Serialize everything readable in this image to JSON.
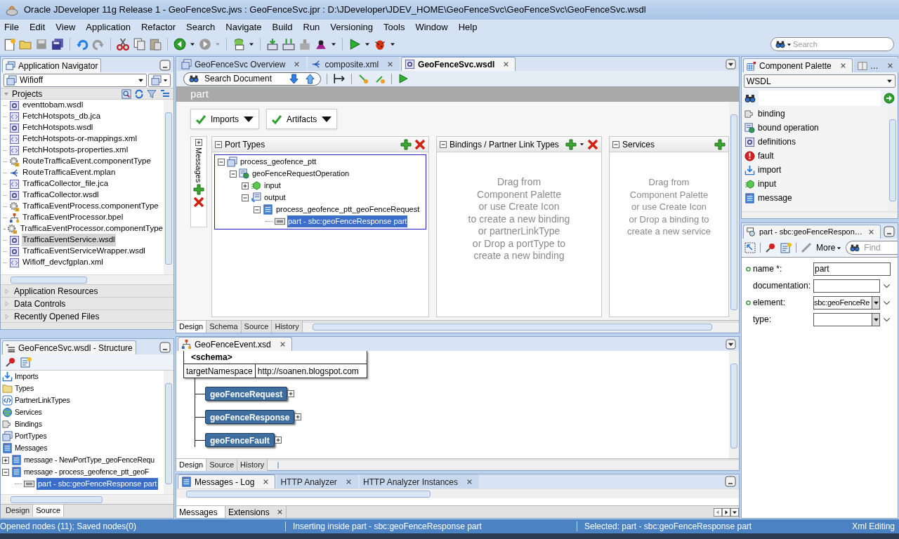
{
  "window": {
    "title": "Oracle JDeveloper 11g Release 1 - GeoFenceSvc.jws : GeoFenceSvc.jpr : D:\\JDeveloper\\JDEV_HOME\\GeoFenceSvc\\GeoFenceSvc\\GeoFenceSvc.wsdl"
  },
  "menu": [
    "File",
    "Edit",
    "View",
    "Application",
    "Refactor",
    "Search",
    "Navigate",
    "Build",
    "Run",
    "Versioning",
    "Tools",
    "Window",
    "Help"
  ],
  "search": {
    "placeholder": "Search"
  },
  "navigator": {
    "tab": "Application Navigator",
    "app": "Wifioff",
    "section": "Projects",
    "files": [
      {
        "name": "eventtobam.wsdl",
        "kind": "wsdl",
        "selected": false
      },
      {
        "name": "FetchHotspots_db.jca",
        "kind": "xml",
        "selected": false
      },
      {
        "name": "FetchHotspots.wsdl",
        "kind": "wsdl",
        "selected": false
      },
      {
        "name": "FetchHotspots-or-mappings.xml",
        "kind": "xml",
        "selected": false
      },
      {
        "name": "FetchHotspots-properties.xml",
        "kind": "xml",
        "selected": false
      },
      {
        "name": "RouteTrafficaEvent.componentType",
        "kind": "gear",
        "selected": false
      },
      {
        "name": "RouteTrafficaEvent.mplan",
        "kind": "mplan",
        "selected": false
      },
      {
        "name": "TrafficaCollector_file.jca",
        "kind": "xml",
        "selected": false
      },
      {
        "name": "TrafficaCollector.wsdl",
        "kind": "wsdl",
        "selected": false
      },
      {
        "name": "TrafficaEventProcess.componentType",
        "kind": "gear",
        "selected": false
      },
      {
        "name": "TrafficaEventProcessor.bpel",
        "kind": "bpel",
        "selected": false
      },
      {
        "name": "TrafficaEventProcessor.componentType",
        "kind": "gear",
        "selected": false
      },
      {
        "name": "TrafficaEventService.wsdl",
        "kind": "wsdl",
        "selected": true
      },
      {
        "name": "TrafficaEventServiceWrapper.wsdl",
        "kind": "wsdl",
        "selected": false
      },
      {
        "name": "Wifioff_devcfgplan.xml",
        "kind": "xml",
        "selected": false
      }
    ],
    "accordions": [
      "Application Resources",
      "Data Controls",
      "Recently Opened Files"
    ]
  },
  "structure": {
    "tab": "GeoFenceSvc.wsdl - Structure",
    "items": [
      {
        "name": "Imports",
        "kind": "import",
        "selected": false
      },
      {
        "name": "Types",
        "kind": "folder",
        "selected": false
      },
      {
        "name": "PartnerLinkTypes",
        "kind": "partner",
        "selected": false
      },
      {
        "name": "Services",
        "kind": "service",
        "selected": false
      },
      {
        "name": "Bindings",
        "kind": "binding",
        "selected": false
      },
      {
        "name": "PortTypes",
        "kind": "porttype",
        "selected": false
      },
      {
        "name": "Messages",
        "kind": "message",
        "selected": false
      },
      {
        "name": "message - NewPortType_geoFenceRequ",
        "kind": "message",
        "selected": false,
        "expanded": false
      },
      {
        "name": "message - process_geofence_ptt_geoF",
        "kind": "message",
        "selected": false,
        "expanded": true,
        "children": [
          {
            "name": "part - sbc:geoFenceResponse part",
            "kind": "part",
            "selected": true
          }
        ]
      }
    ],
    "tabs": [
      {
        "label": "Design",
        "selected": false
      },
      {
        "label": "Source",
        "selected": true
      }
    ]
  },
  "editor": {
    "tabs": [
      {
        "label": "GeoFenceSvc Overview",
        "selected": false
      },
      {
        "label": "composite.xml",
        "selected": false
      },
      {
        "label": "GeoFenceSvc.wsdl",
        "selected": true
      }
    ],
    "search_label": "Search Document",
    "breadcrumb": "part",
    "filters": [
      "Imports",
      "Artifacts"
    ],
    "messages_label": "Messages",
    "port_types": {
      "title": "Port Types",
      "tree": [
        {
          "name": "process_geofence_ptt",
          "kind": "porttype",
          "selected": false,
          "expanded": true,
          "children": [
            {
              "name": "geoFenceRequestOperation",
              "kind": "operation",
              "selected": false,
              "expanded": true,
              "children": [
                {
                  "name": "input",
                  "kind": "input",
                  "selected": false,
                  "expanded": false
                },
                {
                  "name": "output",
                  "kind": "output",
                  "selected": false,
                  "expanded": true,
                  "children": [
                    {
                      "name": "process_geofence_ptt_geoFenceRequest",
                      "kind": "message",
                      "selected": false,
                      "expanded": true,
                      "children": [
                        {
                          "name": "part - sbc:geoFenceResponse part",
                          "kind": "part",
                          "selected": true
                        }
                      ]
                    }
                  ]
                }
              ]
            }
          ]
        }
      ]
    },
    "bindings": {
      "title": "Bindings / Partner Link Types",
      "hint_lines": [
        "Drag from",
        "Component Palette",
        "or use Create Icon",
        "to create a new binding",
        "or partnerLinkType",
        "or Drop a portType to",
        "create a new binding"
      ]
    },
    "services": {
      "title": "Services",
      "hint_lines": [
        "Drag from",
        "Component Palette",
        "or use Create Icon",
        "or Drop a binding to",
        "create a new service"
      ]
    },
    "bottom_tabs": [
      {
        "label": "Design",
        "selected": true
      },
      {
        "label": "Schema",
        "selected": false
      },
      {
        "label": "Source",
        "selected": false
      },
      {
        "label": "History",
        "selected": false
      }
    ]
  },
  "schema_editor": {
    "tab": "GeoFenceEvent.xsd",
    "header": "<schema>",
    "attribute": "targetNamespace",
    "value": "http://soanen.blogspot.com",
    "elements": [
      "geoFenceRequest",
      "geoFenceResponse",
      "geoFenceFault"
    ],
    "tabs": [
      {
        "label": "Design",
        "selected": true
      },
      {
        "label": "Source",
        "selected": false
      },
      {
        "label": "History",
        "selected": false
      }
    ]
  },
  "log": {
    "tabs": [
      {
        "label": "Messages - Log",
        "selected": true
      },
      {
        "label": "HTTP Analyzer",
        "selected": false
      },
      {
        "label": "HTTP Analyzer Instances",
        "selected": false
      }
    ],
    "subtabs": [
      {
        "label": "Messages",
        "selected": true
      },
      {
        "label": "Extensions",
        "selected": false
      }
    ]
  },
  "palette": {
    "tabs": [
      {
        "label": "Component Palette",
        "selected": true
      },
      {
        "label": "…",
        "selected": false
      }
    ],
    "category": "WSDL",
    "items": [
      {
        "name": "binding",
        "kind": "binding"
      },
      {
        "name": "bound operation",
        "kind": "operation"
      },
      {
        "name": "definitions",
        "kind": "wsdl"
      },
      {
        "name": "fault",
        "kind": "fault"
      },
      {
        "name": "import",
        "kind": "import"
      },
      {
        "name": "input",
        "kind": "input"
      },
      {
        "name": "message",
        "kind": "message"
      }
    ]
  },
  "inspector": {
    "tab": "part - sbc:geoFenceRespon…",
    "more": "More",
    "find_placeholder": "Find",
    "fields": [
      {
        "label": "name *:",
        "kind": "text",
        "value": "part",
        "required": true,
        "has_editor": false
      },
      {
        "label": "documentation:",
        "kind": "text",
        "required": false,
        "has_editor": true
      },
      {
        "label": "element:",
        "kind": "combo",
        "value": "sbc:geoFenceRe",
        "required": true,
        "has_editor": true
      },
      {
        "label": "type:",
        "kind": "combo",
        "required": false,
        "has_editor": true
      }
    ]
  },
  "status_bar": [
    "Opened nodes (11); Saved nodes(0)",
    "Inserting inside part - sbc:geoFenceResponse part",
    "Selected: part - sbc:geoFenceResponse part",
    "Xml Editing"
  ]
}
